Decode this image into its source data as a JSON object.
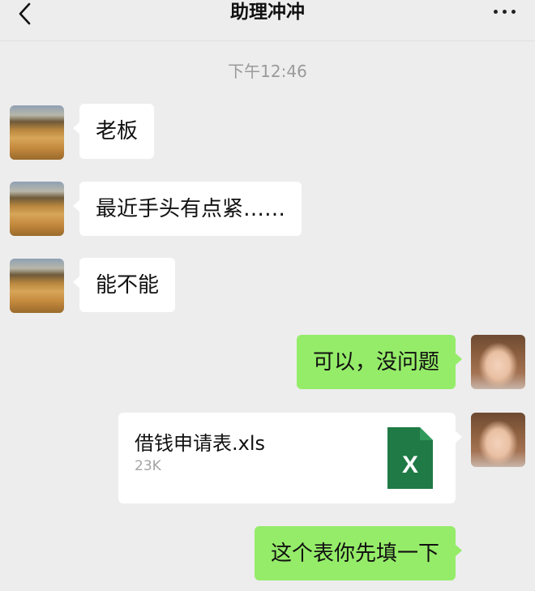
{
  "header": {
    "title": "助理冲冲",
    "back_icon": "chevron-left-icon",
    "more_icon": "more-dots-icon"
  },
  "chat": {
    "timestamp": "下午12:46",
    "messages": [
      {
        "side": "left",
        "avatar": "desert-avatar",
        "text": "老板"
      },
      {
        "side": "left",
        "avatar": "desert-avatar",
        "text": "最近手头有点紧……"
      },
      {
        "side": "left",
        "avatar": "desert-avatar",
        "text": "能不能"
      },
      {
        "side": "right",
        "avatar": "girl-avatar",
        "text": "可以，没问题"
      },
      {
        "side": "right",
        "avatar": "girl-avatar",
        "type": "file",
        "file_name": "借钱申请表.xls",
        "file_size": "23K",
        "file_icon": "excel-file-icon",
        "file_icon_letter": "X"
      },
      {
        "side": "right",
        "text": "这个表你先填一下"
      }
    ]
  },
  "colors": {
    "background": "#ededed",
    "incoming_bubble": "#ffffff",
    "outgoing_bubble": "#95ec69",
    "excel_green": "#1f7a45"
  }
}
